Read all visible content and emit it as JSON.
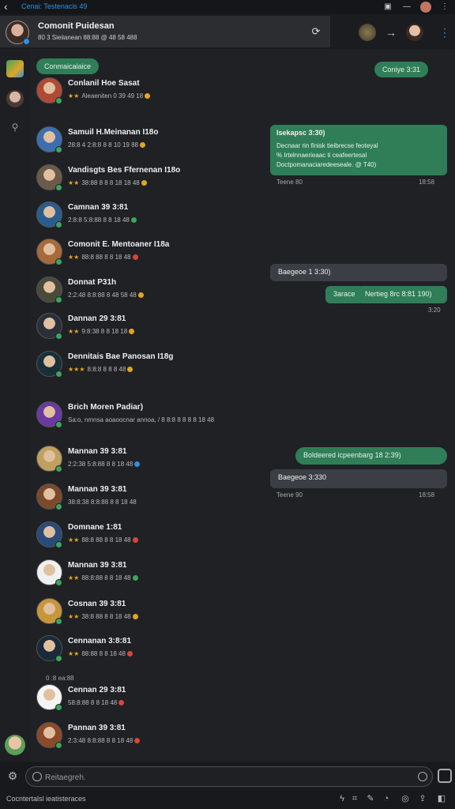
{
  "app": {
    "title": "Cenai: Testenacis 49"
  },
  "header": {
    "name": "Comonit Puidesan",
    "subtitle": "80 3 Sieiianean 88:88 @ 48 58 488"
  },
  "feed": {
    "label_top": "Conmaicaiaice",
    "right_pill_top": "Coniye 3:31",
    "rows": [
      {
        "name": "Conlanil Hoe Sasat",
        "meta": "Aleaeniten  0  39  49  18",
        "stars": "★★",
        "dots": [
          "#e0a526"
        ],
        "avatar": "#b04a35"
      },
      {
        "name": "Samuil H.Meinanan I18o",
        "meta": "28:8 4 2:8:8 8  8  10  19  88",
        "stars": "",
        "dots": [
          "#e0a526"
        ],
        "avatar": "#3d6fb0"
      },
      {
        "name": "Vandisgts Bes Ffernenan I18o",
        "meta": "38:88 8 8  8  18  18  48",
        "stars": "★★",
        "dots": [
          "#e0a526"
        ],
        "avatar": "#6a5a4a"
      },
      {
        "name": "Camnan 39 3:81",
        "meta": "2:8:8 5:8:88 8  8  18  48",
        "stars": "",
        "dots": [
          "#3ba55c"
        ],
        "avatar": "#2a5d8f"
      },
      {
        "name": "Comonit E. Mentoaner I18a",
        "meta": "88:8 88 8  8  18  48",
        "stars": "★★",
        "dots": [
          "#d8453a"
        ],
        "avatar": "#a86a3a"
      },
      {
        "name": "Donnat P31h",
        "meta": "2:2:48 8:8:88 8  48  58  48",
        "stars": "",
        "dots": [
          "#e0a526"
        ],
        "avatar": "#4a4a3a"
      },
      {
        "name": "Dannan 29 3:81",
        "meta": "9:8:38 8  8  18  18",
        "stars": "★★",
        "dots": [
          "#e0a526"
        ],
        "avatar": "#2a2f3a"
      },
      {
        "name": "Dennitais Bae Panosan I18g",
        "meta": "8:8:8 8  8  8  48",
        "stars": "★★★",
        "dots": [
          "#e0a526"
        ],
        "avatar": "#18303a"
      },
      {
        "name": "Brich Moren Padiar)",
        "meta": "Sa:o, nmnsa aoaoocnar annoa, / 8 8:8 8 8  8  8  18  48",
        "stars": "",
        "dots": [],
        "avatar": "#6a3aa0"
      },
      {
        "name": "Mannan 39 3:81",
        "meta": "2:2:38 5:8:88 8  8  18  48",
        "stars": "",
        "dots": [
          "#2f8fe0"
        ],
        "avatar": "#c0a060"
      },
      {
        "name": "Mannan 39 3:81",
        "meta": "38:8:38 8:8:88 8  8  18  48",
        "stars": "",
        "dots": [],
        "avatar": "#7a4a2a"
      },
      {
        "name": "Domnane 1:81",
        "meta": "88:8 88 8  8  18  48",
        "stars": "★★",
        "dots": [
          "#d8453a"
        ],
        "avatar": "#2a4a7a"
      },
      {
        "name": "Mannan 39 3:81",
        "meta": "88:8:88 8  8  18  48",
        "stars": "★★",
        "dots": [
          "#3ba55c"
        ],
        "avatar": "#f0f0f0"
      },
      {
        "name": "Cosnan 39 3:81",
        "meta": "38:8 88 8  8  18  48",
        "stars": "★★",
        "dots": [
          "#e0a526"
        ],
        "avatar": "#c8963a"
      },
      {
        "name": "Cennanan 3:8:81",
        "meta": "88:88 8  8  18  48",
        "stars": "★★",
        "dots": [
          "#d8453a"
        ],
        "avatar": "#1a2a3a"
      },
      {
        "name": "Cennan 29 3:81",
        "meta": "58:8:88 8  8  18  48",
        "stars": "",
        "dots": [
          "#d8453a"
        ],
        "avatar": "#f5f5f5"
      },
      {
        "name": "Pannan 39 3:81",
        "meta": "2:3:48 8:8:88 8  8  18  48",
        "stars": "",
        "dots": [
          "#d8453a"
        ],
        "avatar": "#8a4a2a"
      }
    ],
    "small_row": "0 :8 ea:88",
    "card1": {
      "title": "Isekapsc 3:30)",
      "line1": "Decnaar rin finisk tieibrecse feoteyal",
      "line2": "% Irtelnnaerieaac ti ceafeertesal",
      "line3": "Doctpomanaciaredeeseale. @ T40)",
      "ts_left": "Teene 80",
      "ts_right": "18:58"
    },
    "pill_bubble": "Baegeoe 1 3:30)",
    "pill_green_a": "3arace",
    "pill_green_b": "Nertieg 8rc 8:81 190)",
    "ts_mid": "3:20",
    "pill_bottom_1": "Boldeered icpeenbarg 18 2:39)",
    "pill_bottom_2": "Baegeoe 3:330",
    "ts_bottom_left": "Teene 90",
    "ts_bottom_right": "18:58"
  },
  "composer": {
    "placeholder": "Reitaegreh.",
    "footer": "Cocntertalsl ieatisteraces"
  },
  "colors": {
    "accent_green": "#2f7e58",
    "link_blue": "#2f8fe0",
    "star": "#e0a526"
  }
}
